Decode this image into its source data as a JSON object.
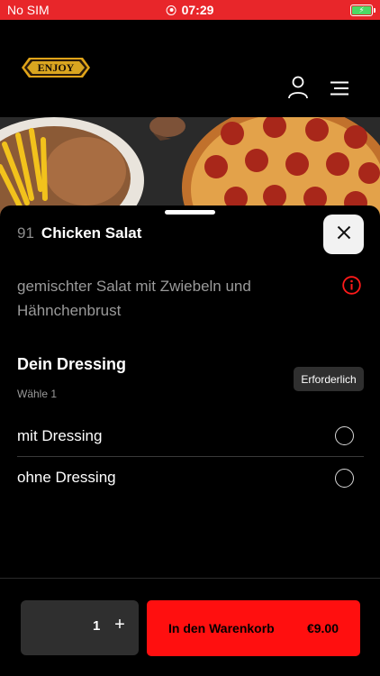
{
  "status_bar": {
    "carrier": "No SIM",
    "time": "07:29"
  },
  "header": {
    "logo_text": "ENJOY",
    "icons": [
      "user-icon",
      "menu-icon"
    ]
  },
  "item": {
    "number": "91",
    "name": "Chicken Salat",
    "description": "gemischter Salat mit Zwiebeln und Hähnchenbrust"
  },
  "option_group": {
    "title": "Dein Dressing",
    "subtitle": "Wähle 1",
    "required_label": "Erforderlich",
    "options": [
      {
        "label": "mit Dressing",
        "selected": false
      },
      {
        "label": "ohne Dressing",
        "selected": false
      }
    ]
  },
  "cart": {
    "quantity": "1",
    "plus_label": "+",
    "add_label": "In den Warenkorb",
    "price": "€9.00"
  },
  "colors": {
    "accent": "#ff0f0f",
    "status_bar": "#e8262a"
  }
}
